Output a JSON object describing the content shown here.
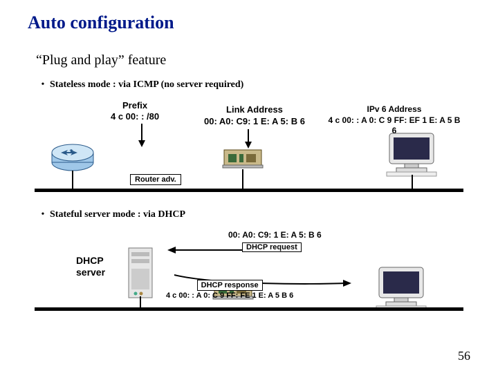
{
  "title": "Auto configuration",
  "subtitle": "“Plug and play” feature",
  "bullets": {
    "stateless": "Stateless mode : via ICMP (no server required)",
    "stateful": "Stateful server mode : via DHCP"
  },
  "stateless": {
    "prefix_label": "Prefix",
    "prefix_value": "4 c 00: : /80",
    "link_title": "Link Address",
    "link_value": "00: A0: C9: 1 E: A 5: B 6",
    "ipv6_title": "IPv 6 Address",
    "ipv6_value": "4 c 00: : A 0: C 9 FF: EF 1 E: A 5 B 6",
    "router_adv": "Router adv."
  },
  "stateful": {
    "dhcp_server_label1": "DHCP",
    "dhcp_server_label2": "server",
    "mac": "00: A0: C9: 1 E: A 5: B 6",
    "dhcp_request": "DHCP request",
    "dhcp_response": "DHCP response",
    "dhcp_response_addr": "4 c 00: : A 0: C 9 FF: FE 1 E: A 5 B 6"
  },
  "page_number": "56"
}
